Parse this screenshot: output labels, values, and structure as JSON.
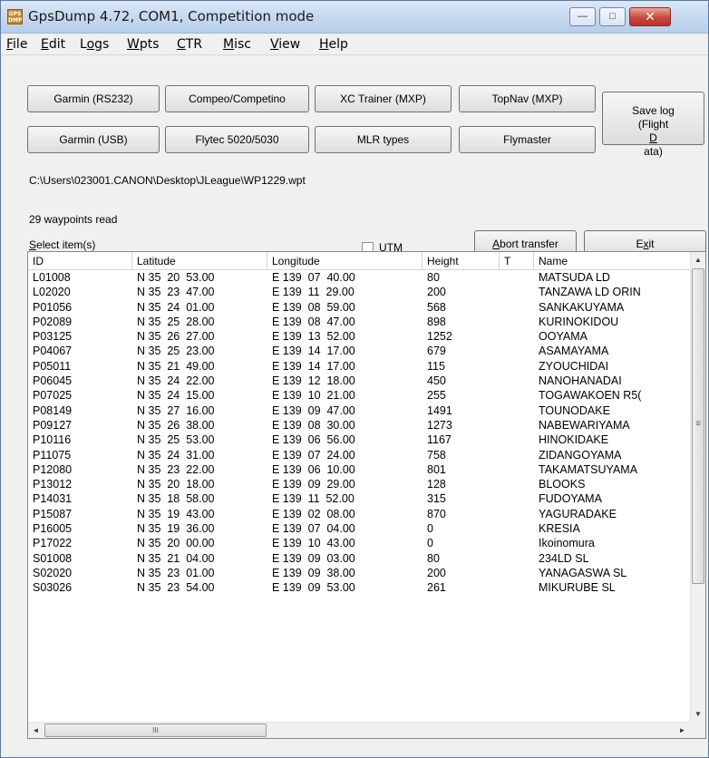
{
  "window": {
    "title": "GpsDump 4.72, COM1, Competition mode",
    "icon_text": "GPS DMP",
    "minimize_label": "—",
    "maximize_label": "□",
    "close_label": "✕"
  },
  "menu": [
    {
      "u": "F",
      "rest": "ile"
    },
    {
      "u": "E",
      "rest": "dit"
    },
    {
      "pre": "L",
      "u": "o",
      "rest": "gs"
    },
    {
      "u": "W",
      "rest": "pts"
    },
    {
      "u": "C",
      "rest": "TR"
    },
    {
      "u": "M",
      "rest": "isc"
    },
    {
      "u": "V",
      "rest": "iew"
    },
    {
      "u": "H",
      "rest": "elp"
    }
  ],
  "buttons": {
    "garmin_rs232": "Garmin (RS232)",
    "compeo": "Compeo/Competino",
    "xc_trainer": "XC Trainer (MXP)",
    "topnav": "TopNav (MXP)",
    "garmin_usb": "Garmin (USB)",
    "flytec": "Flytec 5020/5030",
    "mlr": "MLR types",
    "flymaster": "Flymaster",
    "save_log_line1": "Save log",
    "save_log_pre": "(Flight ",
    "save_log_u": "D",
    "save_log_post": "ata)",
    "abort_u": "A",
    "abort_rest": "bort transfer",
    "exit_pre": "E",
    "exit_u": "x",
    "exit_post": "it"
  },
  "file_path": "C:\\Users\\023001.CANON\\Desktop\\JLeague\\WP1229.wpt",
  "status": "29 waypoints read",
  "select_u": "S",
  "select_rest": "elect item(s)",
  "utm_u": "U",
  "utm_rest": "TM",
  "utm_checked": false,
  "table": {
    "headers": [
      "ID",
      "Latitude",
      "Longitude",
      "Height",
      "T",
      "Name"
    ],
    "rows": [
      [
        "L01008",
        "N 35  20  53.00",
        "E 139  07  40.00",
        "80",
        "",
        "MATSUDA LD"
      ],
      [
        "L02020",
        "N 35  23  47.00",
        "E 139  11  29.00",
        "200",
        "",
        "TANZAWA LD ORIN"
      ],
      [
        "P01056",
        "N 35  24  01.00",
        "E 139  08  59.00",
        "568",
        "",
        "SANKAKUYAMA"
      ],
      [
        "P02089",
        "N 35  25  28.00",
        "E 139  08  47.00",
        "898",
        "",
        "KURINOKIDOU"
      ],
      [
        "P03125",
        "N 35  26  27.00",
        "E 139  13  52.00",
        "1252",
        "",
        "OOYAMA"
      ],
      [
        "P04067",
        "N 35  25  23.00",
        "E 139  14  17.00",
        "679",
        "",
        "ASAMAYAMA"
      ],
      [
        "P05011",
        "N 35  21  49.00",
        "E 139  14  17.00",
        "115",
        "",
        "ZYOUCHIDAI"
      ],
      [
        "P06045",
        "N 35  24  22.00",
        "E 139  12  18.00",
        "450",
        "",
        "NANOHANADAI"
      ],
      [
        "P07025",
        "N 35  24  15.00",
        "E 139  10  21.00",
        "255",
        "",
        "TOGAWAKOEN R5("
      ],
      [
        "P08149",
        "N 35  27  16.00",
        "E 139  09  47.00",
        "1491",
        "",
        "TOUNODAKE"
      ],
      [
        "P09127",
        "N 35  26  38.00",
        "E 139  08  30.00",
        "1273",
        "",
        "NABEWARIYAMA"
      ],
      [
        "P10116",
        "N 35  25  53.00",
        "E 139  06  56.00",
        "1167",
        "",
        "HINOKIDAKE"
      ],
      [
        "P11075",
        "N 35  24  31.00",
        "E 139  07  24.00",
        "758",
        "",
        "ZIDANGOYAMA"
      ],
      [
        "P12080",
        "N 35  23  22.00",
        "E 139  06  10.00",
        "801",
        "",
        "TAKAMATSUYAMA"
      ],
      [
        "P13012",
        "N 35  20  18.00",
        "E 139  09  29.00",
        "128",
        "",
        "BLOOKS"
      ],
      [
        "P14031",
        "N 35  18  58.00",
        "E 139  11  52.00",
        "315",
        "",
        "FUDOYAMA"
      ],
      [
        "P15087",
        "N 35  19  43.00",
        "E 139  02  08.00",
        "870",
        "",
        "YAGURADAKE"
      ],
      [
        "P16005",
        "N 35  19  36.00",
        "E 139  07  04.00",
        "0",
        "",
        "KRESIA"
      ],
      [
        "P17022",
        "N 35  20  00.00",
        "E 139  10  43.00",
        "0",
        "",
        "Ikoinomura"
      ],
      [
        "S01008",
        "N 35  21  04.00",
        "E 139  09  03.00",
        "80",
        "",
        "234LD SL"
      ],
      [
        "S02020",
        "N 35  23  01.00",
        "E 139  09  38.00",
        "200",
        "",
        "YANAGASWA SL"
      ],
      [
        "S03026",
        "N 35  23  54.00",
        "E 139  09  53.00",
        "261",
        "",
        "MIKURUBE SL"
      ]
    ]
  },
  "scroll": {
    "up": "▲",
    "down": "▼",
    "left": "◄",
    "right": "►",
    "grip": "III",
    "vgrip": "≡"
  }
}
